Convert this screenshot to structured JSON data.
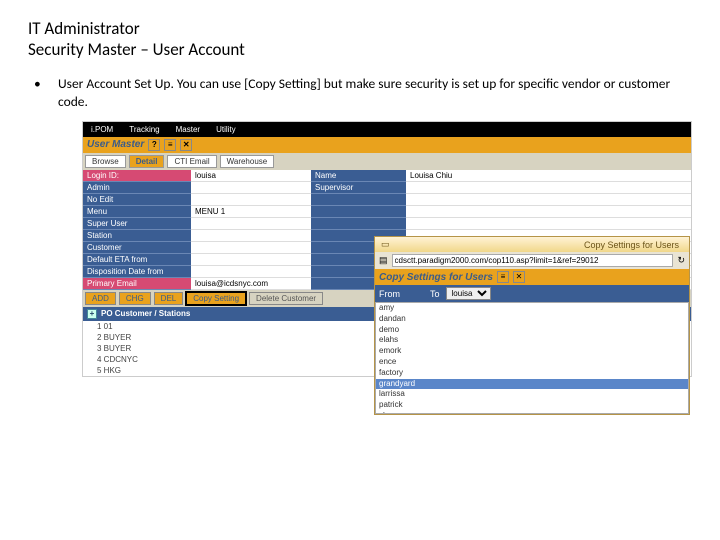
{
  "title": "IT Administrator\nSecurity Master – User Account",
  "bullet": "User Account Set Up. You can use [Copy Setting] but make sure security is set up for specific vendor or customer code.",
  "app": {
    "topnav": [
      "i.POM",
      "Tracking",
      "Master",
      "Utility"
    ],
    "panel_title": "User Master",
    "tabs": [
      "Browse",
      "Detail",
      "CTI Email",
      "Warehouse"
    ],
    "active_tab": "Detail",
    "rows": [
      {
        "l1": "Login ID:",
        "v1": "louisa",
        "l2": "Name",
        "v2": "Louisa Chiu",
        "hl": true
      },
      {
        "l1": "Admin",
        "v1": "",
        "l2": "Supervisor",
        "v2": ""
      },
      {
        "l1": "No Edit",
        "v1": "",
        "l2": "",
        "v2": ""
      },
      {
        "l1": "Menu",
        "v1": "MENU 1",
        "l2": "",
        "v2": ""
      },
      {
        "l1": "Super User",
        "v1": "",
        "l2": "",
        "v2": ""
      },
      {
        "l1": "Station",
        "v1": "",
        "l2": "",
        "v2": ""
      },
      {
        "l1": "Customer",
        "v1": "",
        "l2": "",
        "v2": ""
      },
      {
        "l1": "Default ETA from",
        "v1": "",
        "l2": "",
        "v2": ""
      },
      {
        "l1": "Disposition Date from",
        "v1": "",
        "l2": "",
        "v2": ""
      },
      {
        "l1": "Primary Email",
        "v1": "louisa@icdsnyc.com",
        "l2": "",
        "v2": "",
        "hl": true
      }
    ],
    "buttons": [
      "ADD",
      "CHG",
      "DEL",
      "Copy Setting",
      "Delete Customer"
    ],
    "section": "PO Customer / Stations",
    "list": [
      "1 01",
      "2 BUYER",
      "3 BUYER",
      "4 CDCNYC",
      "5 HKG"
    ]
  },
  "popup": {
    "window_title": "Copy Settings for Users",
    "url": "cdsctt.paradigm2000.com/cop110.asp?limit=1&ref=29012",
    "panel_title": "Copy Settings for Users",
    "from_label": "From",
    "to_label": "To",
    "to_value": "louisa",
    "items": [
      "amy",
      "dandan",
      "demo",
      "elahs",
      "emork",
      "ence",
      "factory",
      "grandyard",
      "larrissa",
      "patrick",
      "sh pper"
    ],
    "selected": "grandyard"
  }
}
